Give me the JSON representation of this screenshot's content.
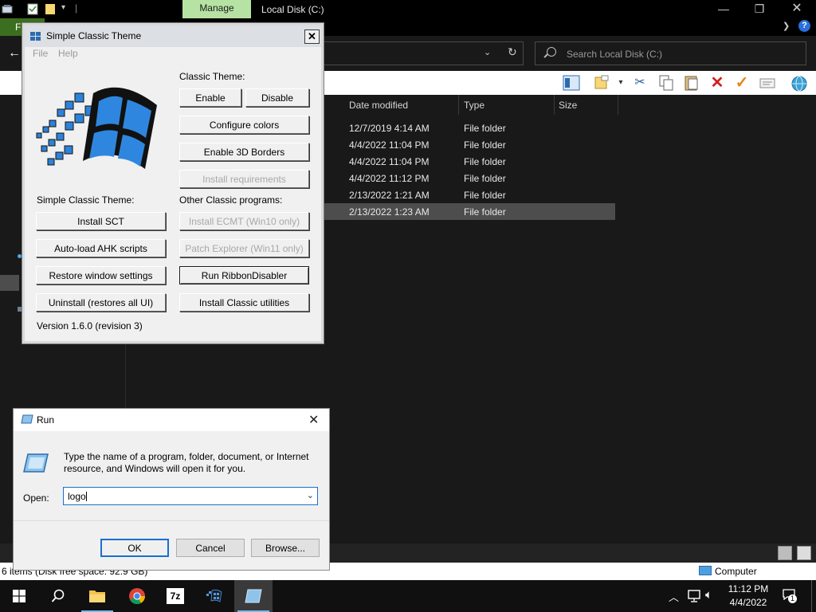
{
  "explorer": {
    "manage_tab": "Manage",
    "title": "Local Disk (C:)",
    "file_tab": "F",
    "search_placeholder": "Search Local Disk (C:)",
    "columns": {
      "date": "Date modified",
      "type": "Type",
      "size": "Size"
    },
    "rows": [
      {
        "date": "12/7/2019 4:14 AM",
        "type": "File folder"
      },
      {
        "date": "4/4/2022 11:04 PM",
        "type": "File folder"
      },
      {
        "date": "4/4/2022 11:04 PM",
        "type": "File folder"
      },
      {
        "date": "4/4/2022 11:12 PM",
        "type": "File folder"
      },
      {
        "date": "2/13/2022 1:21 AM",
        "type": "File folder"
      },
      {
        "date": "2/13/2022 1:23 AM",
        "type": "File folder"
      }
    ],
    "status": "6 items (Disk free space: 92.9 GB)",
    "status_right": "Computer"
  },
  "sct": {
    "title": "Simple Classic Theme",
    "menu": {
      "file": "File",
      "help": "Help"
    },
    "classic_theme_label": "Classic Theme:",
    "enable": "Enable",
    "disable": "Disable",
    "configure_colors": "Configure colors",
    "enable_3d_borders": "Enable 3D Borders",
    "install_requirements": "Install requirements",
    "sct_label": "Simple Classic Theme:",
    "other_label": "Other Classic programs:",
    "install_sct": "Install SCT",
    "install_ecmt": "Install ECMT (Win10 only)",
    "autoload_ahk": "Auto-load AHK scripts",
    "patch_explorer": "Patch Explorer (Win11 only)",
    "restore_window": "Restore window settings",
    "run_ribbon": "Run RibbonDisabler",
    "uninstall": "Uninstall (restores all UI)",
    "install_classic": "Install Classic utilities",
    "version": "Version 1.6.0 (revision 3)"
  },
  "run": {
    "title": "Run",
    "description": "Type the name of a program, folder, document, or Internet resource, and Windows will open it for you.",
    "open_label": "Open:",
    "input_value": "logo",
    "ok": "OK",
    "cancel": "Cancel",
    "browse": "Browse..."
  },
  "taskbar": {
    "time": "11:12 PM",
    "date": "4/4/2022",
    "notification_count": "1"
  }
}
